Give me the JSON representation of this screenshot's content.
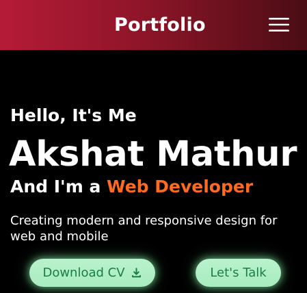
{
  "header": {
    "brand": "Portfolio",
    "menu_icon": "hamburger-menu-icon",
    "gradient_colors": [
      "#b51b36",
      "#8f1529",
      "#4b0d14"
    ]
  },
  "hero": {
    "greeting": "Hello, It's Me",
    "name": "Akshat Mathur",
    "role_prefix": "And I'm a ",
    "role_highlight": "Web Developer",
    "description": "Creating modern and responsive design for web and mobile",
    "highlight_color": "#ff6a21"
  },
  "actions": {
    "download_cv": "Download CV",
    "download_icon": "download-icon",
    "lets_talk": "Let's Talk",
    "button_color": "#b9f2cd",
    "button_text_color": "#1a7d45"
  }
}
